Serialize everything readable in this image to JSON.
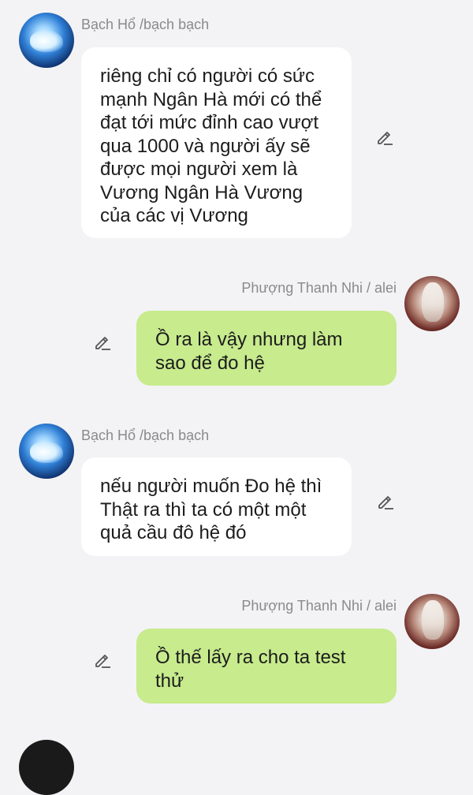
{
  "messages": [
    {
      "side": "left",
      "sender": "Bạch Hổ /bạch bạch",
      "avatar": "white-tiger-avatar",
      "text": "riêng chỉ có  người có sức mạnh Ngân Hà mới có thể đạt tới mức đỉnh cao vượt qua 1000 và người ấy sẽ được mọi người xem là Vương Ngân Hà Vương của các vị Vương"
    },
    {
      "side": "right",
      "sender": "Phượng Thanh Nhi / alei",
      "avatar": "white-haired-girl-avatar",
      "text": "Ồ ra là vậy nhưng làm sao để đo hệ"
    },
    {
      "side": "left",
      "sender": "Bạch Hổ /bạch bạch",
      "avatar": "white-tiger-avatar",
      "text": "nếu người muốn Đo hệ thì Thật ra thì ta có một một quả cầu đô hệ đó"
    },
    {
      "side": "right",
      "sender": "Phượng Thanh Nhi / alei",
      "avatar": "white-haired-girl-avatar",
      "text": "Ồ thế lấy ra cho ta test thử"
    }
  ],
  "icons": {
    "edit": "pencil-edit-icon"
  },
  "colors": {
    "background": "#f3f3f5",
    "left_bubble": "#ffffff",
    "right_bubble": "#c7eb8d",
    "sender_name": "#8a8a8a"
  }
}
